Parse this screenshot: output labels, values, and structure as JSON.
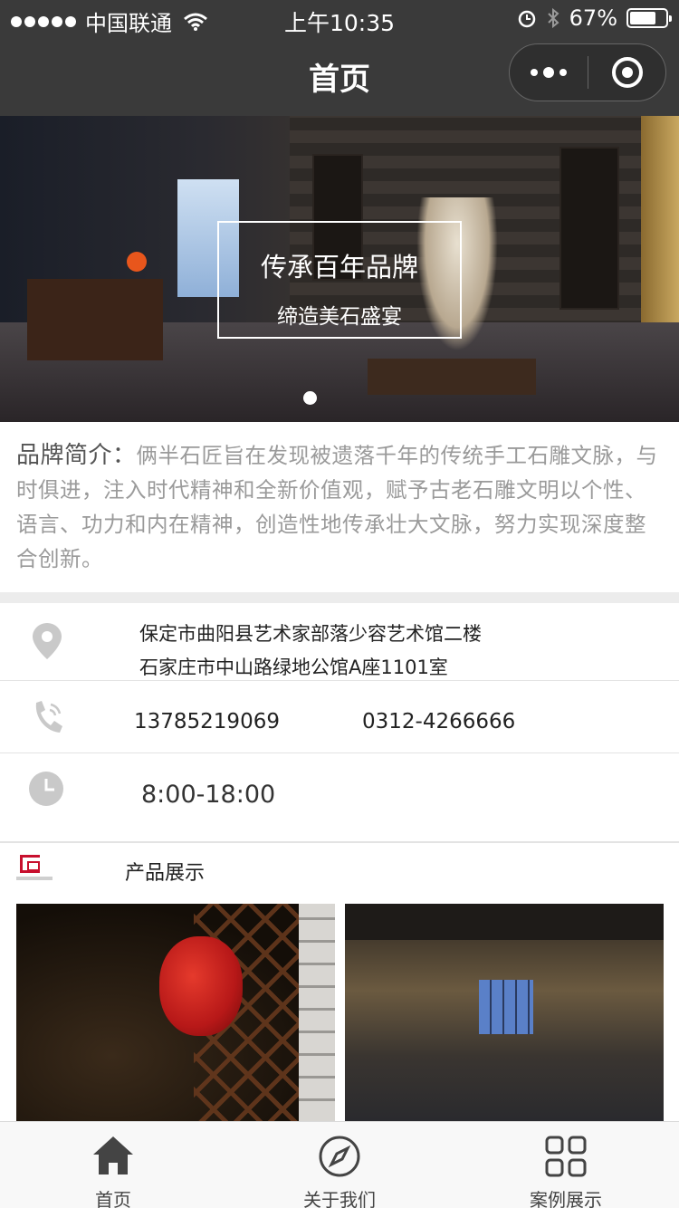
{
  "status_bar": {
    "carrier": "中国联通",
    "time": "上午10:35",
    "battery": "67%"
  },
  "nav": {
    "title": "首页"
  },
  "banner": {
    "title": "传承百年品牌",
    "subtitle": "缔造美石盛宴"
  },
  "intro": {
    "label": "品牌简介：",
    "text": "俩半石匠旨在发现被遗落千年的传统手工石雕文脉，与时俱进，注入时代精神和全新价值观，赋予古老石雕文明以个性、语言、功力和内在精神，创造性地传承壮大文脉，努力实现深度整合创新。"
  },
  "contact": {
    "address_1": "保定市曲阳县艺术家部落少容艺术馆二楼",
    "address_2": "石家庄市中山路绿地公馆A座1101室",
    "phone_1": "13785219069",
    "phone_2": "0312-4266666",
    "hours": "8:00-18:00"
  },
  "products": {
    "title": "产品展示"
  },
  "tabs": [
    {
      "label": "首页",
      "icon": "home-icon"
    },
    {
      "label": "关于我们",
      "icon": "compass-icon"
    },
    {
      "label": "案例展示",
      "icon": "grid-icon"
    }
  ],
  "colors": {
    "nav_bg": "#3a3a3a",
    "brand_red": "#c8102e",
    "icon_gray": "#c9c9c9"
  }
}
